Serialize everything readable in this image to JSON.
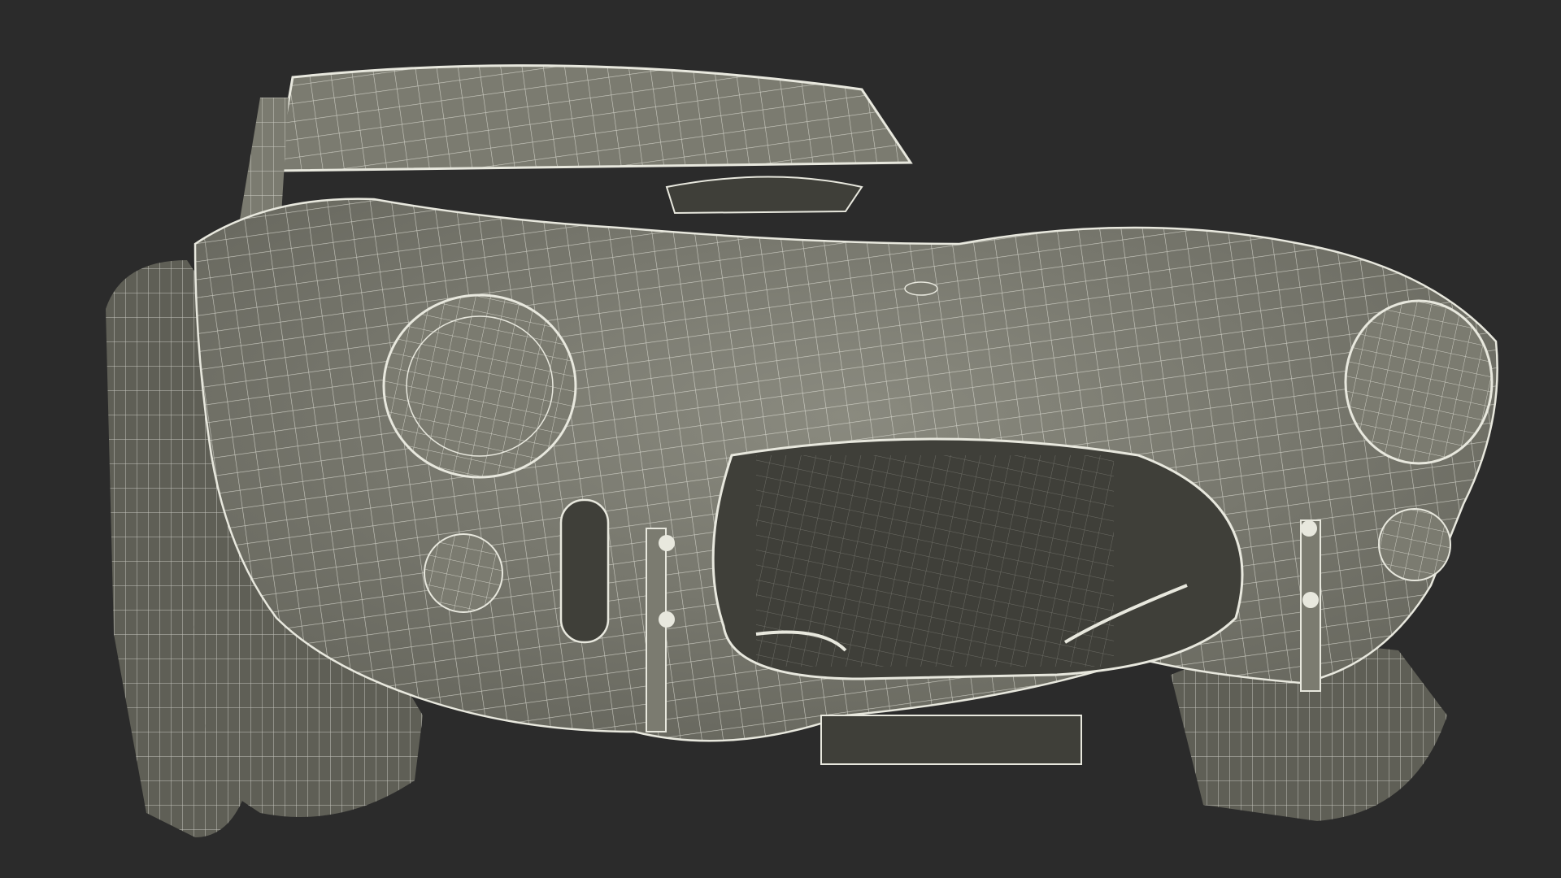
{
  "scene": {
    "background": "#2b2b2b",
    "body_fill": "#7b7b70",
    "body_fill_dark": "#5f5f56",
    "wire_color": "#e8e8de",
    "cavity_fill": "#3f3f39",
    "subject_icon": "wireframe-car-render"
  }
}
